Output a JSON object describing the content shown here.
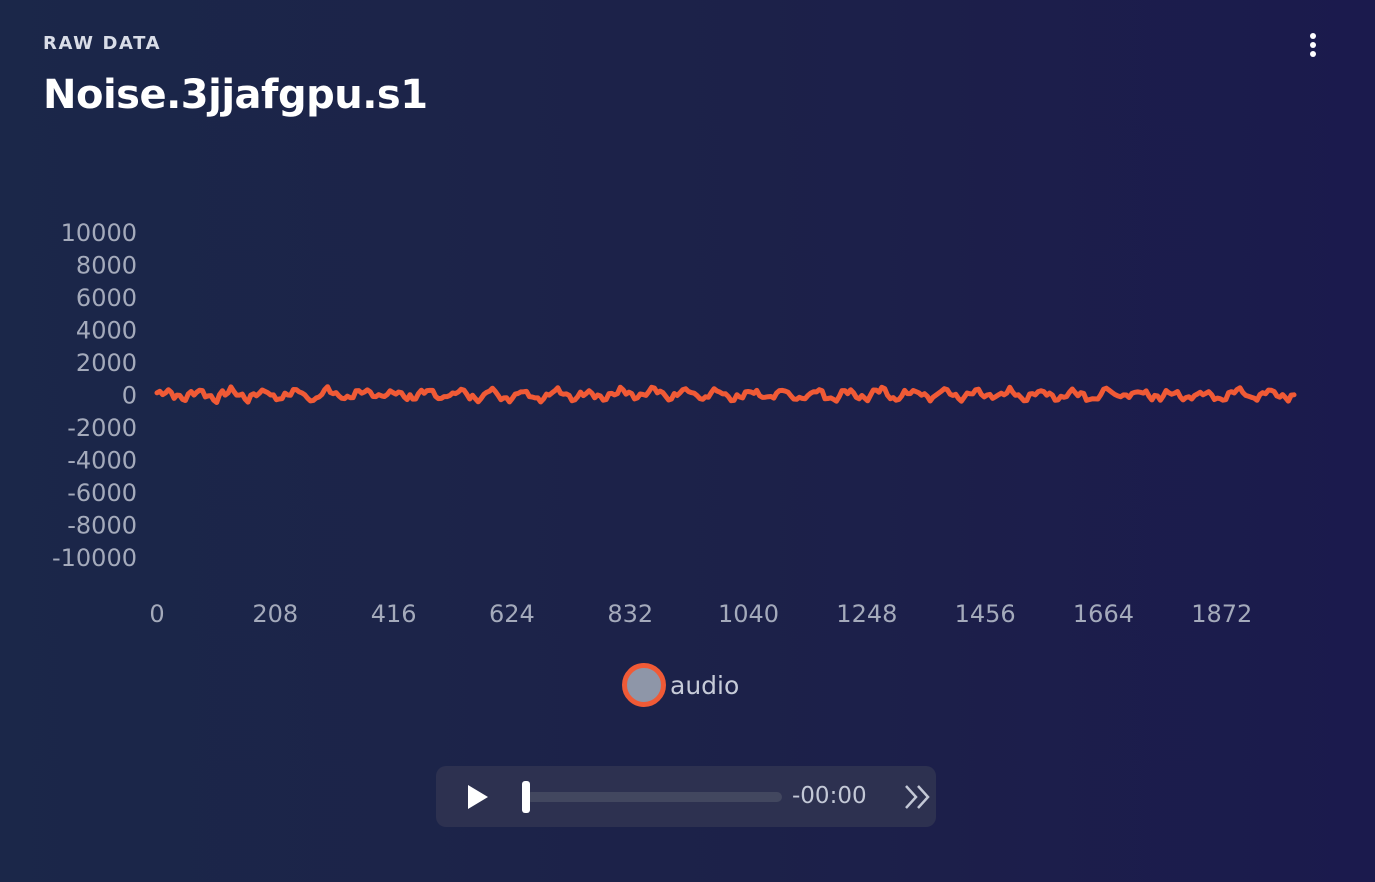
{
  "header": {
    "eyebrow": "RAW DATA",
    "title": "Noise.3jjafgpu.s1",
    "menu_icon": "more-vertical-icon"
  },
  "chart_data": {
    "type": "line",
    "y_ticks": [
      "10000",
      "8000",
      "6000",
      "4000",
      "2000",
      "0",
      "-2000",
      "-4000",
      "-6000",
      "-8000",
      "-10000"
    ],
    "x_ticks": [
      "0",
      "208",
      "416",
      "624",
      "832",
      "1040",
      "1248",
      "1456",
      "1664",
      "1872"
    ],
    "xlim": [
      0,
      1999
    ],
    "ylim": [
      -10000,
      10000
    ],
    "series": [
      {
        "name": "audio",
        "color": "#f05a36"
      }
    ],
    "legend_position": "bottom-center"
  },
  "legend": {
    "label": "audio"
  },
  "player": {
    "play_icon": "play-icon",
    "time": "-00:00",
    "speed_icon": "fast-forward-icon",
    "progress": 0
  },
  "colors": {
    "series": "#f05a36",
    "tick_text": "#a4aabb",
    "player_bg": "#2d3150"
  }
}
